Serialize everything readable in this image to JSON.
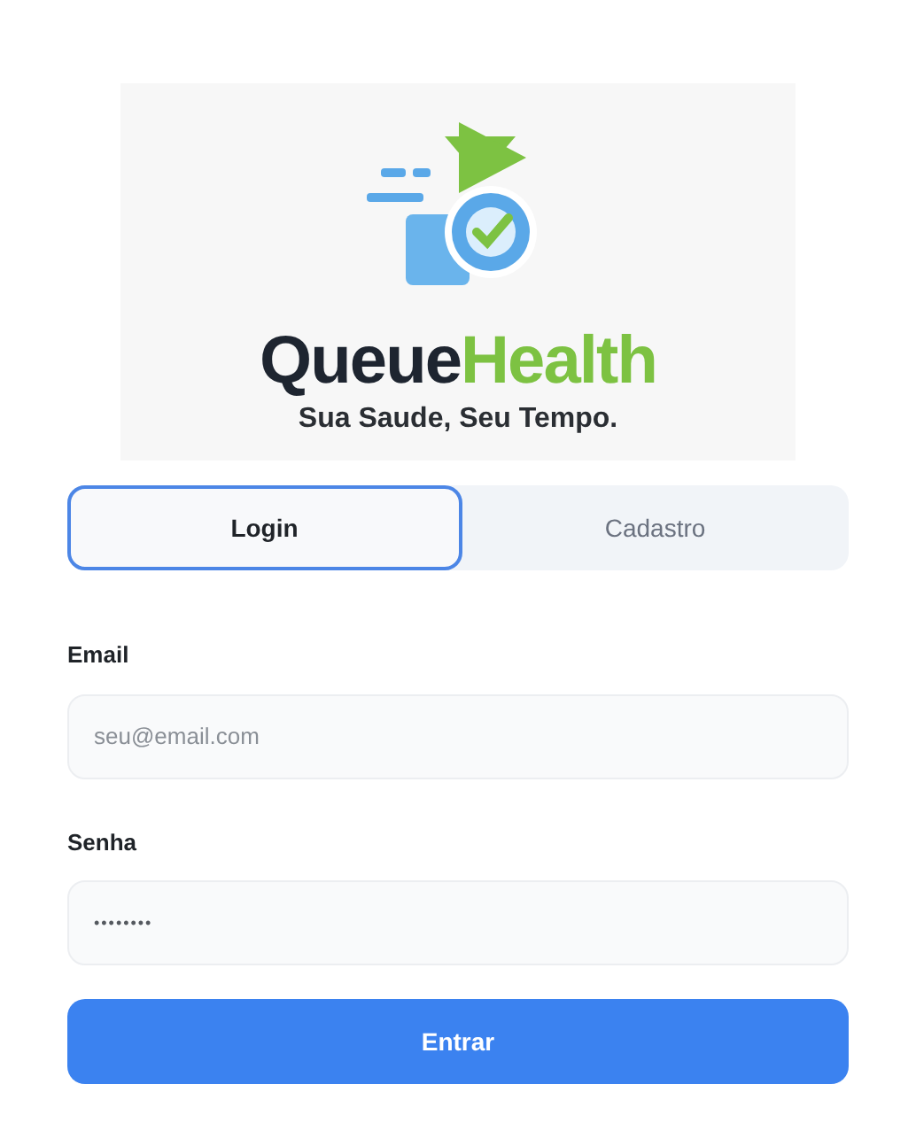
{
  "logo": {
    "name_first": "Queue",
    "name_second": "Health",
    "tagline": "Sua Saude, Seu Tempo."
  },
  "tabs": [
    {
      "label": "Login",
      "selected": true
    },
    {
      "label": "Cadastro",
      "selected": false
    }
  ],
  "fields": [
    {
      "label": "Email",
      "placeholder": "seu@email.com",
      "kind": "email"
    },
    {
      "label": "Senha",
      "placeholder": "••••••••",
      "kind": "password"
    }
  ],
  "submit": "Entrar"
}
